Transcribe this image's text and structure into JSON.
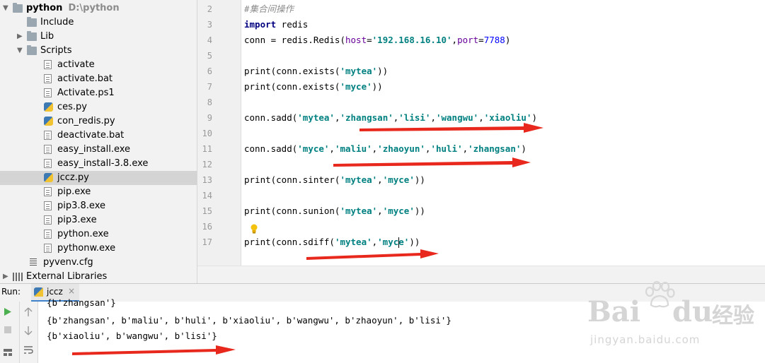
{
  "project": {
    "root_name": "python",
    "root_path": "D:\\python",
    "items": [
      {
        "label": "Include",
        "type": "folder",
        "level": 1,
        "expand": ""
      },
      {
        "label": "Lib",
        "type": "folder",
        "level": 1,
        "expand": "collapsed"
      },
      {
        "label": "Scripts",
        "type": "folder",
        "level": 1,
        "expand": "expanded"
      },
      {
        "label": "activate",
        "type": "file",
        "level": 2
      },
      {
        "label": "activate.bat",
        "type": "file",
        "level": 2
      },
      {
        "label": "Activate.ps1",
        "type": "file",
        "level": 2
      },
      {
        "label": "ces.py",
        "type": "py",
        "level": 2
      },
      {
        "label": "con_redis.py",
        "type": "py",
        "level": 2
      },
      {
        "label": "deactivate.bat",
        "type": "file",
        "level": 2
      },
      {
        "label": "easy_install.exe",
        "type": "file",
        "level": 2
      },
      {
        "label": "easy_install-3.8.exe",
        "type": "file",
        "level": 2
      },
      {
        "label": "jccz.py",
        "type": "py",
        "level": 2,
        "selected": true
      },
      {
        "label": "pip.exe",
        "type": "file",
        "level": 2
      },
      {
        "label": "pip3.8.exe",
        "type": "file",
        "level": 2
      },
      {
        "label": "pip3.exe",
        "type": "file",
        "level": 2
      },
      {
        "label": "python.exe",
        "type": "file",
        "level": 2
      },
      {
        "label": "pythonw.exe",
        "type": "file",
        "level": 2
      },
      {
        "label": "pyvenv.cfg",
        "type": "cfg",
        "level": 1
      },
      {
        "label": "External Libraries",
        "type": "lib",
        "level": 0,
        "expand": "collapsed"
      }
    ]
  },
  "editor": {
    "current_line": "17",
    "lines": [
      {
        "n": "2",
        "tokens": [
          [
            "cmt",
            "#集合间操作"
          ]
        ]
      },
      {
        "n": "3",
        "tokens": [
          [
            "kw",
            "import"
          ],
          [
            "",
            " redis"
          ]
        ]
      },
      {
        "n": "4",
        "tokens": [
          [
            "",
            "conn = redis.Redis("
          ],
          [
            "kwarg",
            "host"
          ],
          [
            "",
            "="
          ],
          [
            "str",
            "'192.168.16.10'"
          ],
          [
            "",
            ","
          ],
          [
            "kwarg",
            "port"
          ],
          [
            "",
            "="
          ],
          [
            "num",
            "7788"
          ],
          [
            "",
            ")"
          ]
        ]
      },
      {
        "n": "5",
        "tokens": []
      },
      {
        "n": "6",
        "tokens": [
          [
            "",
            "print(conn.exists("
          ],
          [
            "str",
            "'mytea'"
          ],
          [
            "",
            "))"
          ]
        ]
      },
      {
        "n": "7",
        "tokens": [
          [
            "",
            "print(conn.exists("
          ],
          [
            "str",
            "'myce'"
          ],
          [
            "",
            "))"
          ]
        ]
      },
      {
        "n": "8",
        "tokens": []
      },
      {
        "n": "9",
        "tokens": [
          [
            "",
            "conn.sadd("
          ],
          [
            "str",
            "'mytea'"
          ],
          [
            "",
            ","
          ],
          [
            "str",
            "'zhangsan'"
          ],
          [
            "",
            ","
          ],
          [
            "str",
            "'lisi'"
          ],
          [
            "",
            ","
          ],
          [
            "str",
            "'wangwu'"
          ],
          [
            "",
            ","
          ],
          [
            "str",
            "'xiaoliu'"
          ],
          [
            "",
            ")"
          ]
        ]
      },
      {
        "n": "10",
        "tokens": []
      },
      {
        "n": "11",
        "tokens": [
          [
            "",
            "conn.sadd("
          ],
          [
            "str",
            "'myce'"
          ],
          [
            "",
            ","
          ],
          [
            "str",
            "'maliu'"
          ],
          [
            "",
            ","
          ],
          [
            "str",
            "'zhaoyun'"
          ],
          [
            "",
            ","
          ],
          [
            "str",
            "'huli'"
          ],
          [
            "",
            ","
          ],
          [
            "str",
            "'zhangsan'"
          ],
          [
            "",
            ")"
          ]
        ]
      },
      {
        "n": "12",
        "tokens": []
      },
      {
        "n": "13",
        "tokens": [
          [
            "",
            "print(conn.sinter("
          ],
          [
            "str",
            "'mytea'"
          ],
          [
            "",
            ","
          ],
          [
            "str",
            "'myce'"
          ],
          [
            "",
            "))"
          ]
        ]
      },
      {
        "n": "14",
        "tokens": []
      },
      {
        "n": "15",
        "tokens": [
          [
            "",
            "print(conn.sunion("
          ],
          [
            "str",
            "'mytea'"
          ],
          [
            "",
            ","
          ],
          [
            "str",
            "'myce'"
          ],
          [
            "",
            "))"
          ]
        ]
      },
      {
        "n": "16",
        "tokens": []
      },
      {
        "n": "17",
        "tokens": [
          [
            "",
            "print(conn.sdiff("
          ],
          [
            "str",
            "'mytea'"
          ],
          [
            "",
            ","
          ],
          [
            "str",
            "'myc"
          ],
          [
            "caret",
            ""
          ],
          [
            "str",
            "e'"
          ],
          [
            "",
            "))"
          ]
        ]
      }
    ]
  },
  "run": {
    "label": "Run:",
    "tab_label": "jccz",
    "tab_close": "×",
    "output": [
      "{b'zhangsan'}",
      "{b'zhangsan', b'maliu', b'huli', b'xiaoliu', b'wangwu', b'zhaoyun', b'lisi'}",
      "{b'xiaoliu', b'wangwu', b'lisi'}"
    ]
  },
  "watermark": {
    "brand_left": "Bai",
    "brand_right": "du",
    "brand_cn": "经验",
    "url": "jingyan.baidu.com"
  },
  "colors": {
    "keyword": "#000080",
    "string": "#008080",
    "kwarg": "#660099",
    "number": "#0000ff",
    "annotation_arrow": "#e8281c",
    "run_icon": "#4caf50"
  }
}
